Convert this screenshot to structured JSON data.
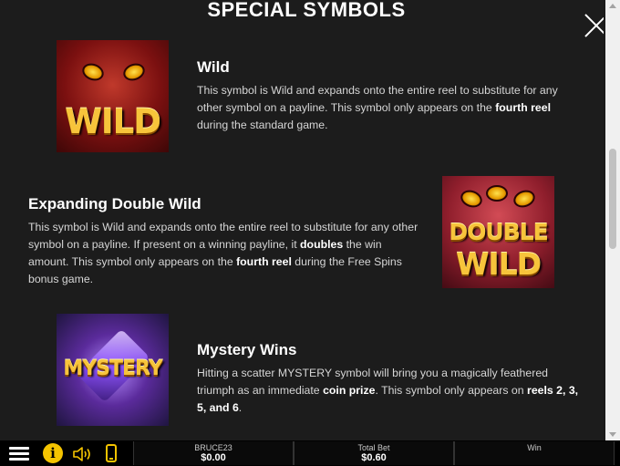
{
  "title": "SPECIAL SYMBOLS",
  "symbols": {
    "wild": {
      "art_text": "WILD",
      "heading": "Wild",
      "desc_parts": [
        "This symbol is Wild and expands onto the entire reel to substitute for any other symbol on a payline. This symbol only appears on the ",
        "fourth reel",
        " during the standard game."
      ]
    },
    "double_wild": {
      "art_text_1": "DOUBLE",
      "art_text_2": "WILD",
      "heading": "Expanding Double Wild",
      "desc_parts": [
        "This symbol is Wild and expands onto the entire reel to substitute for any other symbol on a payline. If present on a winning payline, it ",
        "doubles",
        " the win amount. This symbol only appears on the ",
        "fourth reel",
        " during the Free Spins bonus game."
      ]
    },
    "mystery": {
      "art_text": "MYSTERY",
      "heading": "Mystery Wins",
      "desc_parts": [
        "Hitting a scatter MYSTERY symbol will bring you a magically feathered triumph as an immediate ",
        "coin prize",
        ". This symbol only appears on ",
        "reels 2, 3, 5, and 6",
        "."
      ]
    }
  },
  "bottom_bar": {
    "player": {
      "label": "BRUCE23",
      "value": "$0.00"
    },
    "total_bet": {
      "label": "Total Bet",
      "value": "$0.60"
    },
    "win": {
      "label": "Win",
      "value": ""
    }
  },
  "icons": [
    "menu-icon",
    "info-icon",
    "sound-icon",
    "phone-icon",
    "close-icon"
  ],
  "colors": {
    "background": "#1c1c1c",
    "accent": "#f5c400",
    "heading": "#ffffff",
    "text": "#d6d6d6"
  }
}
